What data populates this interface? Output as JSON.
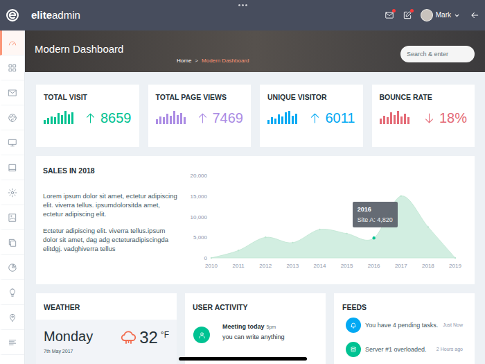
{
  "topbar": {
    "logo_bold": "elite",
    "logo_light": "admin",
    "user": "Mark",
    "mail_unread": true,
    "notes_unread": true
  },
  "header": {
    "title": "Modern Dashboard",
    "breadcrumb": [
      {
        "label": "Home",
        "selected": false
      },
      {
        "label": "Modern Dashboard",
        "selected": true
      }
    ],
    "separator": ">"
  },
  "search": {
    "placeholder": "Search & enter"
  },
  "sidebar": {
    "items": [
      {
        "selected": true
      },
      {
        "selected": false
      },
      {
        "selected": false
      },
      {
        "selected": false
      },
      {
        "selected": false
      },
      {
        "selected": false
      },
      {
        "selected": false
      },
      {
        "selected": false
      },
      {
        "selected": false
      },
      {
        "selected": false
      },
      {
        "selected": false
      },
      {
        "selected": false
      },
      {
        "selected": false
      }
    ]
  },
  "stats": [
    {
      "title": "TOTAL VISIT",
      "value": "8659",
      "kind": "up",
      "color": "#00c292",
      "bars": [
        0.3,
        0.45,
        0.6,
        0.5,
        0.85,
        0.7,
        1,
        0.75,
        0.9
      ]
    },
    {
      "title": "TOTAL PAGE VIEWS",
      "value": "7469",
      "kind": "up",
      "color": "#ab8ce4",
      "bars": [
        0.35,
        0.6,
        0.5,
        0.8,
        0.65,
        1,
        0.7,
        0.85,
        0.55
      ]
    },
    {
      "title": "UNIQUE VISITOR",
      "value": "6011",
      "kind": "up",
      "color": "#03a9f3",
      "bars": [
        0.3,
        0.5,
        0.4,
        0.75,
        0.6,
        0.9,
        1,
        0.65,
        0.8
      ]
    },
    {
      "title": "BOUNCE RATE",
      "value": "18%",
      "kind": "down",
      "color": "#e46a76",
      "bars": [
        0.4,
        0.65,
        0.55,
        0.9,
        0.7,
        1,
        0.6,
        0.8,
        0.5
      ]
    }
  ],
  "sales": {
    "title": "SALES IN 2018",
    "paragraphs": [
      "Lorem ipsum dolor sit amet, ectetur adipiscing elit. viverra tellus. ipsumdolorsitda amet, ectetur adipiscing elit.",
      "Ectetur adipiscing elit. viverra tellus.ipsum dolor sit amet, dag adg ecteturadipiscingda elitdgj. vadghiverra tellus"
    ],
    "chart": {
      "y_ticks": [
        "20,000",
        "15,000",
        "10,000",
        "5,000",
        "0"
      ],
      "x_labels": [
        "2010",
        "2011",
        "2012",
        "2013",
        "2014",
        "2015",
        "2016",
        "2017",
        "2018",
        "2019"
      ],
      "series": [
        {
          "name": "Site A",
          "values": [
            0,
            1800,
            5000,
            3700,
            6900,
            5900,
            4820,
            15000,
            7500,
            0
          ]
        }
      ],
      "tooltip": {
        "title": "2016",
        "label": "Site A: 4,820",
        "index": 6
      }
    }
  },
  "weather": {
    "title": "WEATHER",
    "day": "Monday",
    "date": "7th May 2017",
    "temp": "32",
    "unit": "°F"
  },
  "activity": {
    "title": "USER ACTIVITY",
    "items": [
      {
        "title": "Meeting today",
        "time": "5pm",
        "text": "you can write anything",
        "color": "#00c292"
      }
    ]
  },
  "feeds": {
    "title": "FEEDS",
    "items": [
      {
        "text": "You have 4 pending tasks.",
        "time": "Just Now",
        "color": "#03a9f3"
      },
      {
        "text": "Server #1 overloaded.",
        "time": "2 Hours ago",
        "color": "#00c292"
      }
    ]
  }
}
